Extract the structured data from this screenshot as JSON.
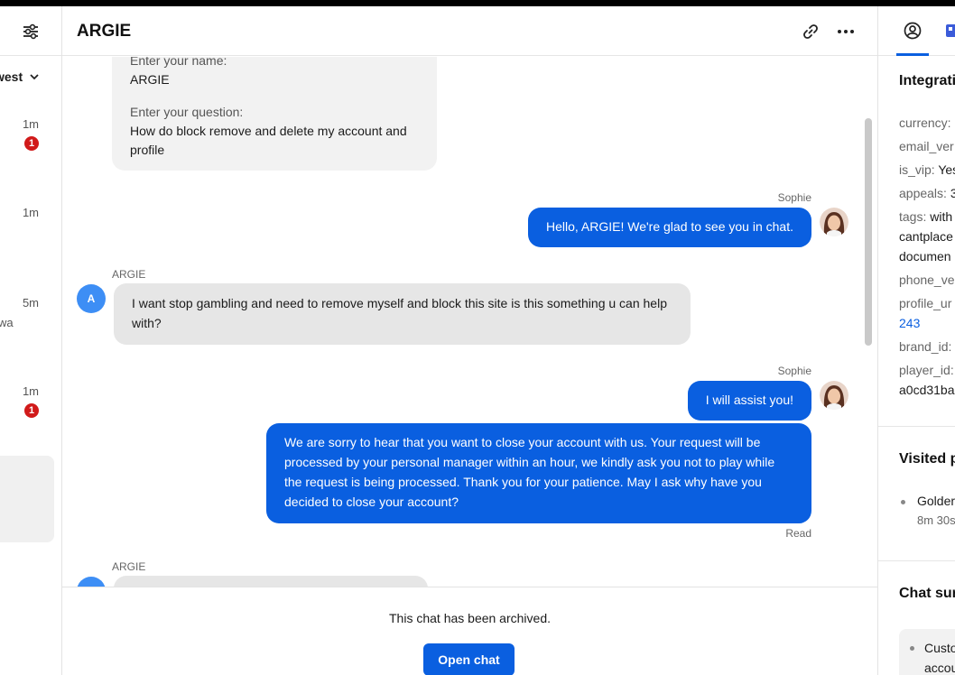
{
  "left": {
    "sort_label": "west",
    "items": [
      {
        "time": "1m",
        "badge": "1",
        "snippet": ""
      },
      {
        "time": "1m",
        "badge": "",
        "snippet": ""
      },
      {
        "time": "5m",
        "badge": "",
        "snippet": "wa"
      },
      {
        "time": "1m",
        "badge": "1",
        "snippet": ""
      }
    ]
  },
  "chat": {
    "title": "ARGIE",
    "form": {
      "name_label": "Enter your name:",
      "name_value": "ARGIE",
      "question_label": "Enter your question:",
      "question_value": "How do block remove and delete my account and profile"
    },
    "messages": [
      {
        "sender": "Sophie",
        "text": "Hello, ARGIE! We're glad to see you in chat."
      },
      {
        "sender": "ARGIE",
        "avatar": "A",
        "text": "I want stop gambling and need to remove myself and block this site is this something u can help with?"
      },
      {
        "sender": "Sophie",
        "text": "I will assist you!"
      },
      {
        "text": "We are sorry to hear that you want to close your account with us. Your request will be processed by your personal manager within an hour, we kindly ask you not to play while the request is being processed. Thank you for your patience. May I ask why have you decided to close your account?",
        "status": "Read"
      },
      {
        "sender": "ARGIE",
        "avatar": "A",
        "text": ""
      }
    ],
    "archived_text": "This chat has been archived.",
    "open_button": "Open chat"
  },
  "right": {
    "section1_title": "Integrati",
    "fields": [
      {
        "key": "currency:",
        "value": ""
      },
      {
        "key": "email_ver",
        "value": ""
      },
      {
        "key": "is_vip:",
        "value": "Yes"
      },
      {
        "key": "appeals:",
        "value": "3"
      },
      {
        "key": "tags:",
        "value": "with"
      },
      {
        "key": "",
        "value": "cantplace"
      },
      {
        "key": "",
        "value": "documen"
      },
      {
        "key": "phone_ve",
        "value": ""
      },
      {
        "key": "profile_ur",
        "value": ""
      },
      {
        "key": "",
        "value": "243"
      },
      {
        "key": "brand_id:",
        "value": ""
      },
      {
        "key": "player_id:",
        "value": ""
      },
      {
        "key": "",
        "value": "a0cd31ba"
      }
    ],
    "section2_title": "Visited p",
    "visited": [
      {
        "name": "Golder",
        "time": "8m 30s"
      }
    ],
    "section3_title": "Chat sur",
    "summary_lines": [
      "Custo",
      "accou"
    ]
  },
  "colors": {
    "accent": "#0a5fe0",
    "badge": "#d11a1a",
    "incoming": "#e6e6e6",
    "avatar": "#3d8ef5"
  }
}
